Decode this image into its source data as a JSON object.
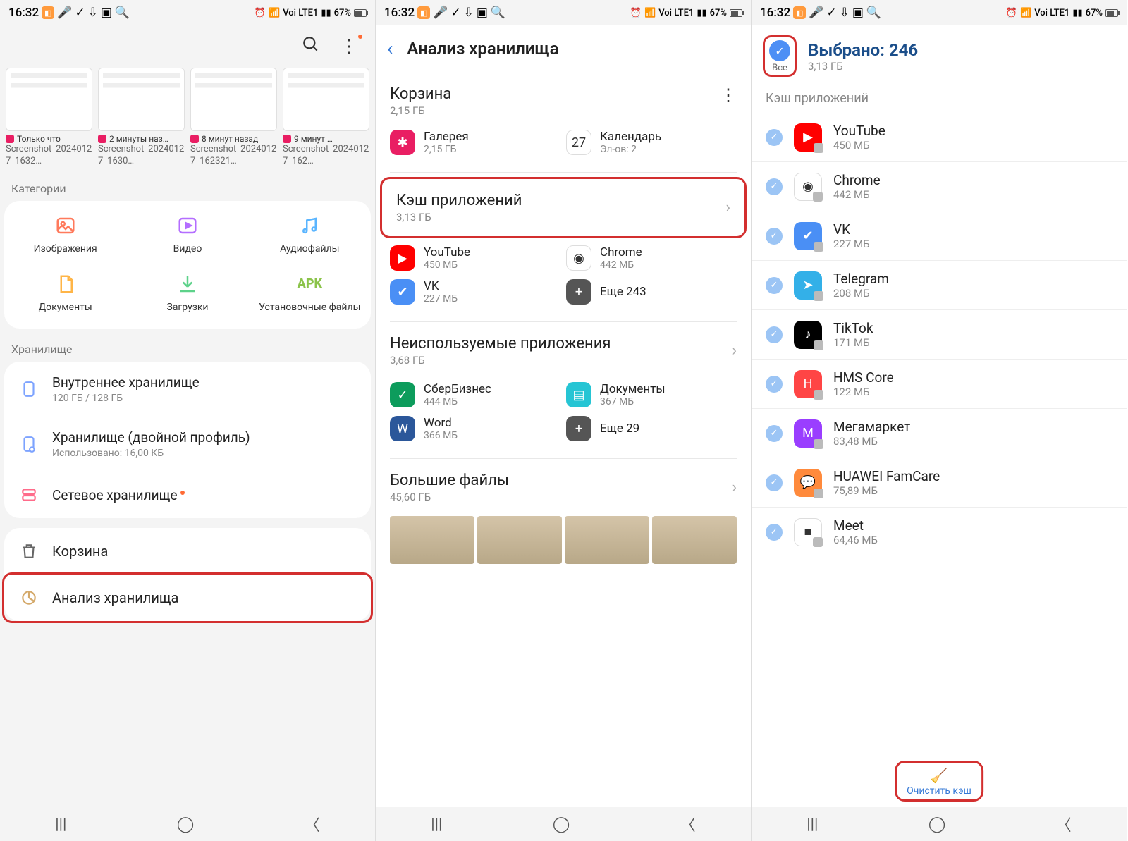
{
  "status_bar": {
    "time": "16:32",
    "battery": "67%",
    "network": "Voi LTE1"
  },
  "screen1": {
    "thumbnails": [
      {
        "time": "Только что",
        "name": "Screenshot_20240127_1632…"
      },
      {
        "time": "2 минуты наз…",
        "name": "Screenshot_20240127_1630…"
      },
      {
        "time": "8 минут назад",
        "name": "Screenshot_20240127_162321…"
      },
      {
        "time": "9 минут …",
        "name": "Screenshot_20240127_162…"
      }
    ],
    "categories_label": "Категории",
    "categories": [
      {
        "label": "Изображения",
        "icon": "image",
        "color": "#ff7a5c"
      },
      {
        "label": "Видео",
        "icon": "video",
        "color": "#b46eff"
      },
      {
        "label": "Аудиофайлы",
        "icon": "audio",
        "color": "#5ab5ff"
      },
      {
        "label": "Документы",
        "icon": "doc",
        "color": "#ffb547"
      },
      {
        "label": "Загрузки",
        "icon": "download",
        "color": "#5dd28a"
      },
      {
        "label": "Установочные файлы",
        "icon": "apk",
        "color": "#8bc34a"
      }
    ],
    "storage_label": "Хранилище",
    "storage_items": [
      {
        "title": "Внутреннее хранилище",
        "sub": "120 ГБ / 128 ГБ",
        "icon": "phone"
      },
      {
        "title": "Хранилище (двойной профиль)",
        "sub": "Использовано: 16,00 КБ",
        "icon": "phone2"
      },
      {
        "title": "Сетевое хранилище",
        "sub": "",
        "icon": "server",
        "dot": true
      }
    ],
    "bottom": [
      {
        "label": "Корзина",
        "icon": "trash"
      },
      {
        "label": "Анализ хранилища",
        "icon": "analyze",
        "highlight": true
      }
    ]
  },
  "screen2": {
    "title": "Анализ хранилища",
    "trash": {
      "title": "Корзина",
      "size": "2,15 ГБ"
    },
    "trash_items": [
      {
        "name": "Галерея",
        "sub": "2,15 ГБ",
        "color": "#e91e63",
        "glyph": "✱"
      },
      {
        "name": "Календарь",
        "sub": "Эл-ов: 2",
        "color": "#fff",
        "glyph": "27"
      }
    ],
    "cache": {
      "title": "Кэш приложений",
      "size": "3,13 ГБ",
      "highlight": true
    },
    "cache_items": [
      {
        "name": "YouTube",
        "sub": "450 МБ",
        "color": "#ff0000",
        "glyph": "▶"
      },
      {
        "name": "Chrome",
        "sub": "442 МБ",
        "color": "#fff",
        "glyph": "◉"
      },
      {
        "name": "VK",
        "sub": "227 МБ",
        "color": "#4a8ff5",
        "glyph": "✔"
      },
      {
        "name": "Еще 243",
        "sub": "",
        "color": "#555",
        "glyph": "+"
      }
    ],
    "unused": {
      "title": "Неиспользуемые приложения",
      "size": "3,68 ГБ"
    },
    "unused_items": [
      {
        "name": "СберБизнес",
        "sub": "444 МБ",
        "color": "#0d9c5c",
        "glyph": "✓"
      },
      {
        "name": "Документы",
        "sub": "367 МБ",
        "color": "#26c5d4",
        "glyph": "▤"
      },
      {
        "name": "Word",
        "sub": "366 МБ",
        "color": "#2b579a",
        "glyph": "W"
      },
      {
        "name": "Еще 29",
        "sub": "",
        "color": "#555",
        "glyph": "+"
      }
    ],
    "bigfiles": {
      "title": "Большие файлы",
      "size": "45,60 ГБ"
    }
  },
  "screen3": {
    "all_label": "Все",
    "selected_title": "Выбрано: 246",
    "selected_sub": "3,13 ГБ",
    "section_label": "Кэш приложений",
    "apps": [
      {
        "name": "YouTube",
        "size": "450 МБ",
        "color": "#ff0000",
        "glyph": "▶"
      },
      {
        "name": "Chrome",
        "size": "442 МБ",
        "color": "#ffffff",
        "glyph": "◉"
      },
      {
        "name": "VK",
        "size": "227 МБ",
        "color": "#4a8ff5",
        "glyph": "✔"
      },
      {
        "name": "Telegram",
        "size": "208 МБ",
        "color": "#33b0e8",
        "glyph": "➤"
      },
      {
        "name": "TikTok",
        "size": "171 МБ",
        "color": "#000000",
        "glyph": "♪"
      },
      {
        "name": "HMS Core",
        "size": "122 МБ",
        "color": "#ff4545",
        "glyph": "H"
      },
      {
        "name": "Мегамаркет",
        "size": "83,48 МБ",
        "color": "#9a3eff",
        "glyph": "М"
      },
      {
        "name": "HUAWEI FamCare",
        "size": "75,89 МБ",
        "color": "#ff8a3c",
        "glyph": "💬"
      },
      {
        "name": "Meet",
        "size": "64,46 МБ",
        "color": "#ffffff",
        "glyph": "■"
      }
    ],
    "clear_label": "Очистить кэш"
  }
}
